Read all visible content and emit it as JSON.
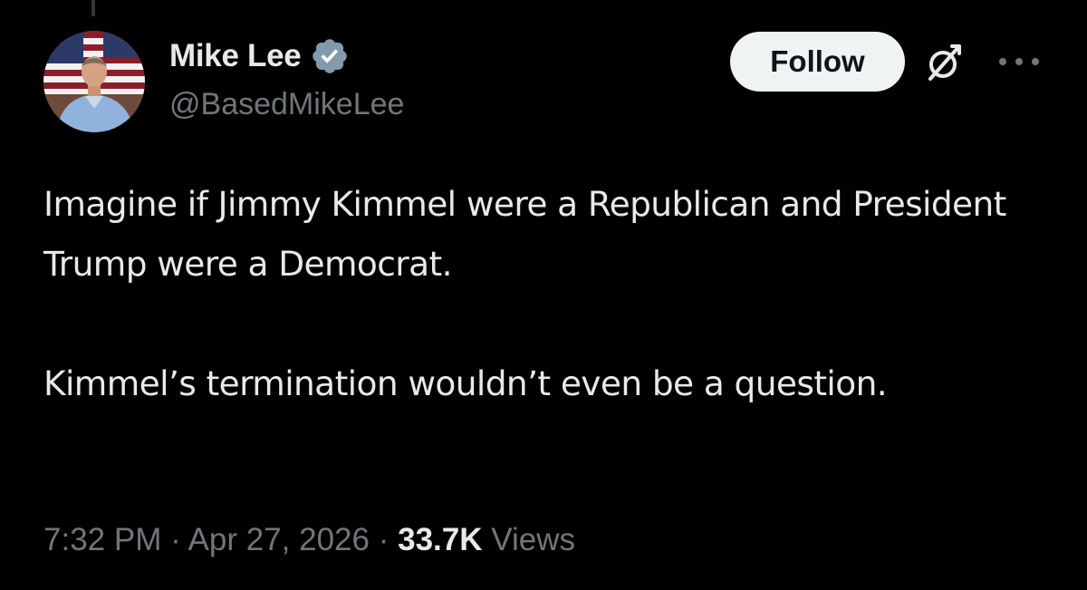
{
  "author": {
    "display_name": "Mike Lee",
    "handle": "@BasedMikeLee",
    "verified": true,
    "avatar_icon": "profile-photo"
  },
  "actions": {
    "follow_label": "Follow",
    "grok_icon": "grok-icon",
    "more_icon": "more-icon"
  },
  "tweet": {
    "paragraphs": [
      "Imagine if Jimmy Kimmel were a Republican and President Trump were a Democrat.",
      "Kimmel’s termination wouldn’t even be a question."
    ]
  },
  "meta": {
    "time": "7:32 PM",
    "separator": "·",
    "date": "Apr 27, 2026",
    "views_count": "33.7K",
    "views_label": "Views"
  },
  "colors": {
    "background": "#000000",
    "primary_text": "#e7e9ea",
    "secondary_text": "#71767b",
    "verified_badge": "#829aab",
    "follow_bg": "#eff3f4"
  }
}
